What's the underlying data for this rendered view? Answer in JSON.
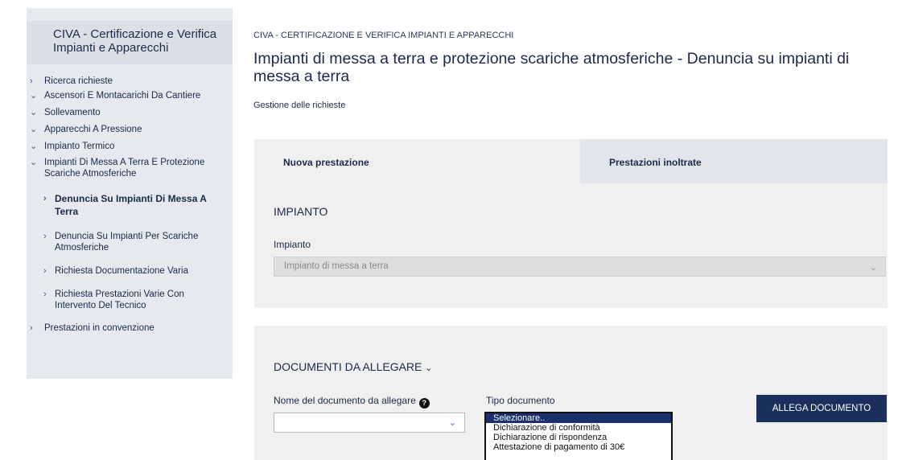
{
  "sidebar": {
    "title": "CIVA - Certificazione e Verifica Impianti e Apparecchi",
    "items": [
      {
        "label": "Ricerca richieste",
        "chevron": "›"
      },
      {
        "label": "Ascensori E Montacarichi Da Cantiere",
        "chevron": "⌄"
      },
      {
        "label": "Sollevamento",
        "chevron": "⌄"
      },
      {
        "label": "Apparecchi A Pressione",
        "chevron": "⌄"
      },
      {
        "label": "Impianto Termico",
        "chevron": "⌄"
      },
      {
        "label": "Impianti Di Messa A Terra E Protezione Scariche Atmosferiche",
        "chevron": "⌄"
      }
    ],
    "subitems": [
      {
        "label": "Denuncia Su Impianti Di Messa A Terra",
        "active": true
      },
      {
        "label": "Denuncia Su Impianti Per Scariche Atmosferiche",
        "active": false
      },
      {
        "label": "Richiesta Documentazione Varia",
        "active": false
      },
      {
        "label": "Richiesta Prestazioni Varie Con Intervento Del Tecnico",
        "active": false
      }
    ],
    "footer_item": {
      "label": "Prestazioni in convenzione",
      "chevron": "›"
    }
  },
  "breadcrumb": "CIVA - CERTIFICAZIONE E VERIFICA IMPIANTI E APPARECCHI",
  "page_title": "Impianti di messa a terra e protezione scariche atmosferiche - Denuncia su impianti di messa a terra",
  "page_subtitle": "Gestione delle richieste",
  "tabs": [
    {
      "label": "Nuova prestazione",
      "active": true
    },
    {
      "label": "Prestazioni inoltrate",
      "active": false
    }
  ],
  "impianto_section": {
    "title": "IMPIANTO",
    "field_label": "Impianto",
    "value": "Impianto di messa a terra"
  },
  "documents_section": {
    "title": "DOCUMENTI DA ALLEGARE",
    "title_chevron": "⌄",
    "name_label": "Nome del documento da allegare",
    "name_value": "",
    "type_label": "Tipo documento",
    "type_options": [
      "Selezionare..",
      "Dichiarazione di conformità",
      "Dichiarazione di rispondenza",
      "Attestazione di pagamento di 30€"
    ],
    "selected_index": 0,
    "attach_button": "ALLEGA DOCUMENTO"
  },
  "colors": {
    "primary": "#1b2f5c",
    "sidebar_bg": "#e6e9ee",
    "panel_bg": "#f0f0f0",
    "selected_option": "#1b2f6b"
  }
}
